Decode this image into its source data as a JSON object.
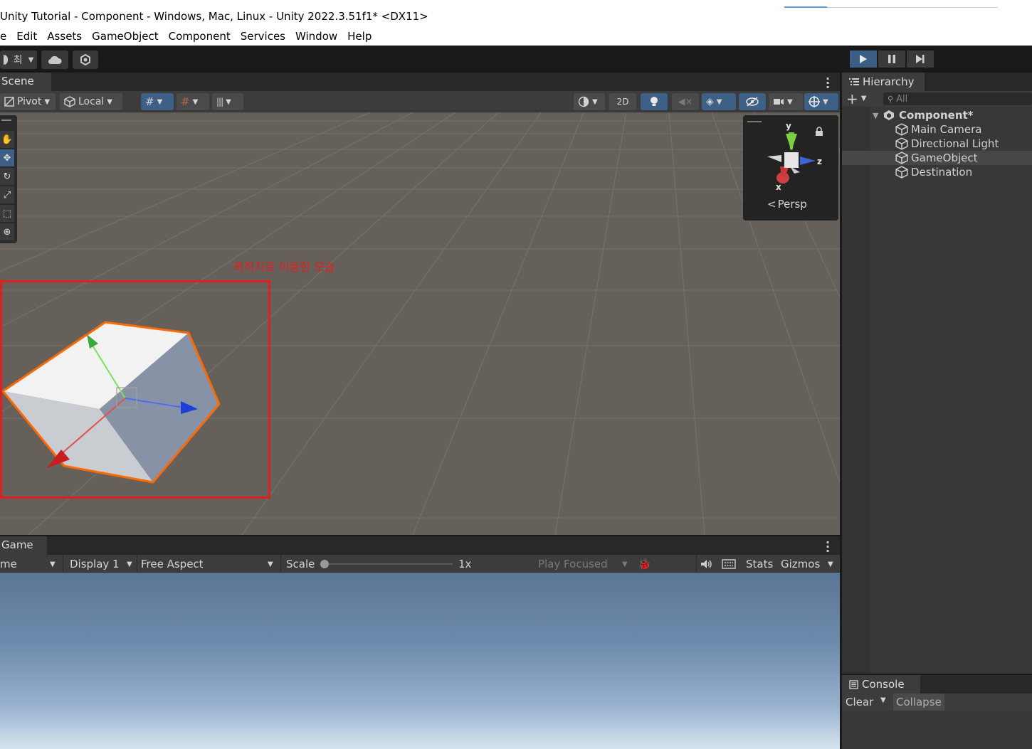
{
  "window": {
    "title": "Unity Tutorial - Component - Windows, Mac, Linux - Unity 2022.3.51f1* <DX11>",
    "menu": [
      "e",
      "Edit",
      "Assets",
      "GameObject",
      "Component",
      "Services",
      "Window",
      "Help"
    ]
  },
  "main_toolbar": {
    "account_label": "최"
  },
  "scene": {
    "tab_label": "Scene",
    "pivot_label": "Pivot",
    "local_label": "Local",
    "mode_2d_label": "2D",
    "annotation": "목적지로 이동한 모습",
    "gizmo": {
      "y": "y",
      "x": "x",
      "z": "z",
      "persp_label": "Persp"
    }
  },
  "game": {
    "tab_label": "Game",
    "mode_label": "me",
    "display_label": "Display 1",
    "aspect_label": "Free Aspect",
    "scale_label": "Scale",
    "scale_value": "1x",
    "play_focused_label": "Play Focused",
    "stats_label": "Stats",
    "gizmos_label": "Gizmos"
  },
  "hierarchy": {
    "tab_label": "Hierarchy",
    "search_placeholder": "All",
    "scene_name": "Component*",
    "items": [
      "Main Camera",
      "Directional Light",
      "GameObject",
      "Destination"
    ],
    "selected_index": 2
  },
  "console": {
    "tab_label": "Console",
    "clear_label": "Clear",
    "collapse_label": "Collapse"
  },
  "colors": {
    "accent_blue": "#3e5f86",
    "highlight_red": "#e02020",
    "selection_orange": "#ff6a00"
  }
}
